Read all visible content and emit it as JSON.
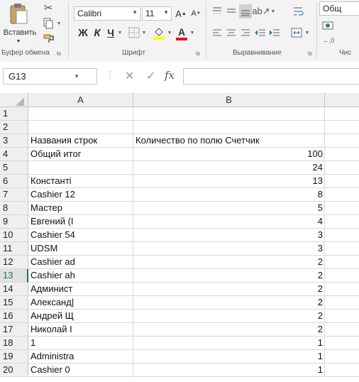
{
  "ribbon": {
    "paste_label": "Вставить",
    "font_name": "Calibri",
    "font_size": "11",
    "bold": "Ж",
    "italic": "К",
    "underline": "Ч",
    "grow_font": "A",
    "shrink_font": "A",
    "font_color_letter": "A",
    "number_format_partial": "Общ",
    "groups": {
      "clipboard": "Буфер обмена",
      "font": "Шрифт",
      "alignment": "Выравнивание",
      "number_partial": "Чис"
    },
    "colors": {
      "highlight": "#ffff00",
      "font_color": "#e81123"
    }
  },
  "formula_bar": {
    "name_box": "G13",
    "formula": "",
    "fx_label": "fx",
    "cancel_glyph": "✕",
    "enter_glyph": "✓"
  },
  "sheet": {
    "columns": [
      "A",
      "B"
    ],
    "rows": [
      {
        "n": "1",
        "a": "",
        "b": ""
      },
      {
        "n": "2",
        "a": "",
        "b": ""
      },
      {
        "n": "3",
        "a": "Названия строк",
        "b": "Количество по полю Счетчик",
        "b_left": true
      },
      {
        "n": "4",
        "a": "Общий итог",
        "b": "100"
      },
      {
        "n": "5",
        "a": "",
        "b": "24"
      },
      {
        "n": "6",
        "a": "Константі",
        "b": "13"
      },
      {
        "n": "7",
        "a": "Cashier 12",
        "b": "8"
      },
      {
        "n": "8",
        "a": "Мастер",
        "b": "5"
      },
      {
        "n": "9",
        "a": "Евгений (I",
        "b": "4"
      },
      {
        "n": "10",
        "a": "Cashier 54",
        "b": "3"
      },
      {
        "n": "11",
        "a": "UDSM",
        "b": "3"
      },
      {
        "n": "12",
        "a": "Cashier ad",
        "b": "2"
      },
      {
        "n": "13",
        "a": "Cashier ah",
        "b": "2",
        "selected": true
      },
      {
        "n": "14",
        "a": "Админист",
        "b": "2"
      },
      {
        "n": "15",
        "a": "Александ|",
        "b": "2"
      },
      {
        "n": "16",
        "a": "Андрей Щ",
        "b": "2"
      },
      {
        "n": "17",
        "a": "Николай I",
        "b": "2"
      },
      {
        "n": "18",
        "a": "1",
        "b": "1"
      },
      {
        "n": "19",
        "a": "Administra",
        "b": "1"
      },
      {
        "n": "20",
        "a": "Cashier 0",
        "b": "1"
      }
    ]
  }
}
